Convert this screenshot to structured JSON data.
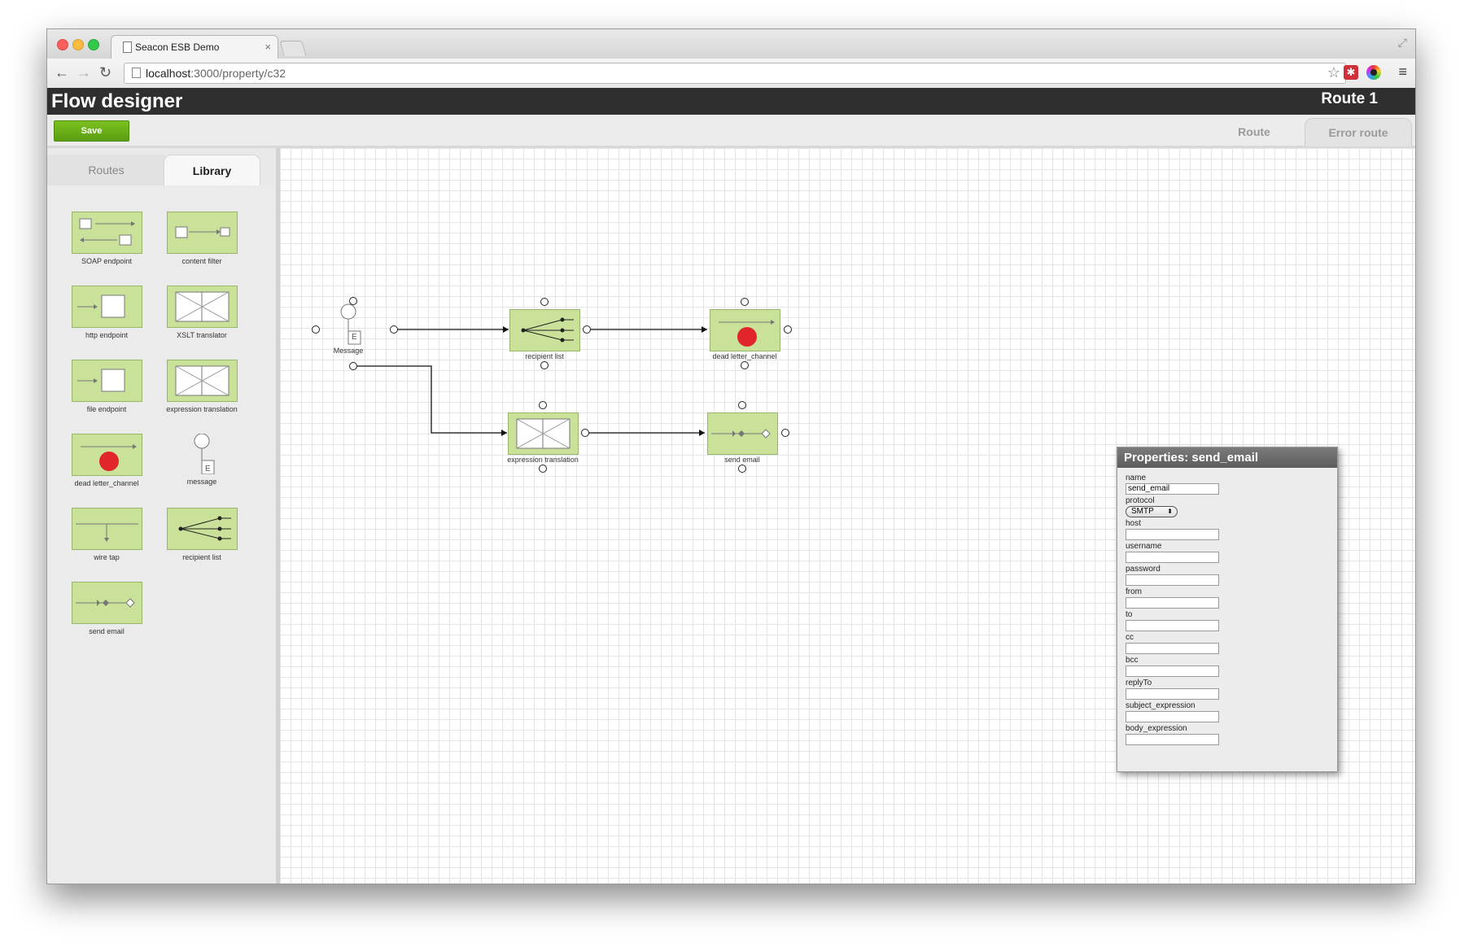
{
  "browser": {
    "tab_title": "Seacon ESB Demo",
    "tab_close": "×",
    "url_host": "localhost",
    "url_rest": ":3000/property/c32",
    "nav": {
      "back": "←",
      "forward": "→",
      "reload": "↻"
    },
    "star": "☆",
    "fullscreen": "⤢",
    "menu": "≡",
    "ext_red_glyph": "✱"
  },
  "app": {
    "title": "Flow designer",
    "route_name": "Route 1",
    "save_label": "Save",
    "route_tabs": [
      "Route",
      "Error route"
    ]
  },
  "sidebar": {
    "tabs": [
      "Routes",
      "Library"
    ],
    "active_tab": "Library",
    "library": [
      {
        "label": "SOAP endpoint",
        "icon": "soap-endpoint-icon"
      },
      {
        "label": "content filter",
        "icon": "content-filter-icon"
      },
      {
        "label": "http endpoint",
        "icon": "http-endpoint-icon"
      },
      {
        "label": "XSLT translator",
        "icon": "xslt-translator-icon"
      },
      {
        "label": "file endpoint",
        "icon": "file-endpoint-icon"
      },
      {
        "label": "expression translation",
        "icon": "expression-translation-icon"
      },
      {
        "label": "dead letter_channel",
        "icon": "dead-letter-channel-icon"
      },
      {
        "label": "message",
        "icon": "message-icon"
      },
      {
        "label": "wire tap",
        "icon": "wire-tap-icon"
      },
      {
        "label": "recipient list",
        "icon": "recipient-list-icon"
      },
      {
        "label": "send email",
        "icon": "send-email-icon"
      }
    ]
  },
  "canvas": {
    "nodes": {
      "message": "Message",
      "message_badge": "E",
      "recipient_list": "recipient list",
      "dead_letter": "dead letter_channel",
      "expression_translation": "expression translation",
      "send_email": "send email"
    }
  },
  "properties": {
    "title": "Properties: send_email",
    "fields": {
      "name": {
        "label": "name",
        "value": "send_email"
      },
      "protocol": {
        "label": "protocol",
        "value": "SMTP",
        "arrow": "⬍"
      },
      "host": {
        "label": "host",
        "value": ""
      },
      "username": {
        "label": "username",
        "value": ""
      },
      "password": {
        "label": "password",
        "value": ""
      },
      "from": {
        "label": "from",
        "value": ""
      },
      "to": {
        "label": "to",
        "value": ""
      },
      "cc": {
        "label": "cc",
        "value": ""
      },
      "bcc": {
        "label": "bcc",
        "value": ""
      },
      "replyTo": {
        "label": "replyTo",
        "value": ""
      },
      "subject_expression": {
        "label": "subject_expression",
        "value": ""
      },
      "body_expression": {
        "label": "body_expression",
        "value": ""
      }
    }
  },
  "colors": {
    "node_fill": "#c9e199",
    "node_border": "#98b66a",
    "save_green": "#6cb018",
    "dead_letter_red": "#e0262a",
    "appbar": "#2f2f2f"
  }
}
